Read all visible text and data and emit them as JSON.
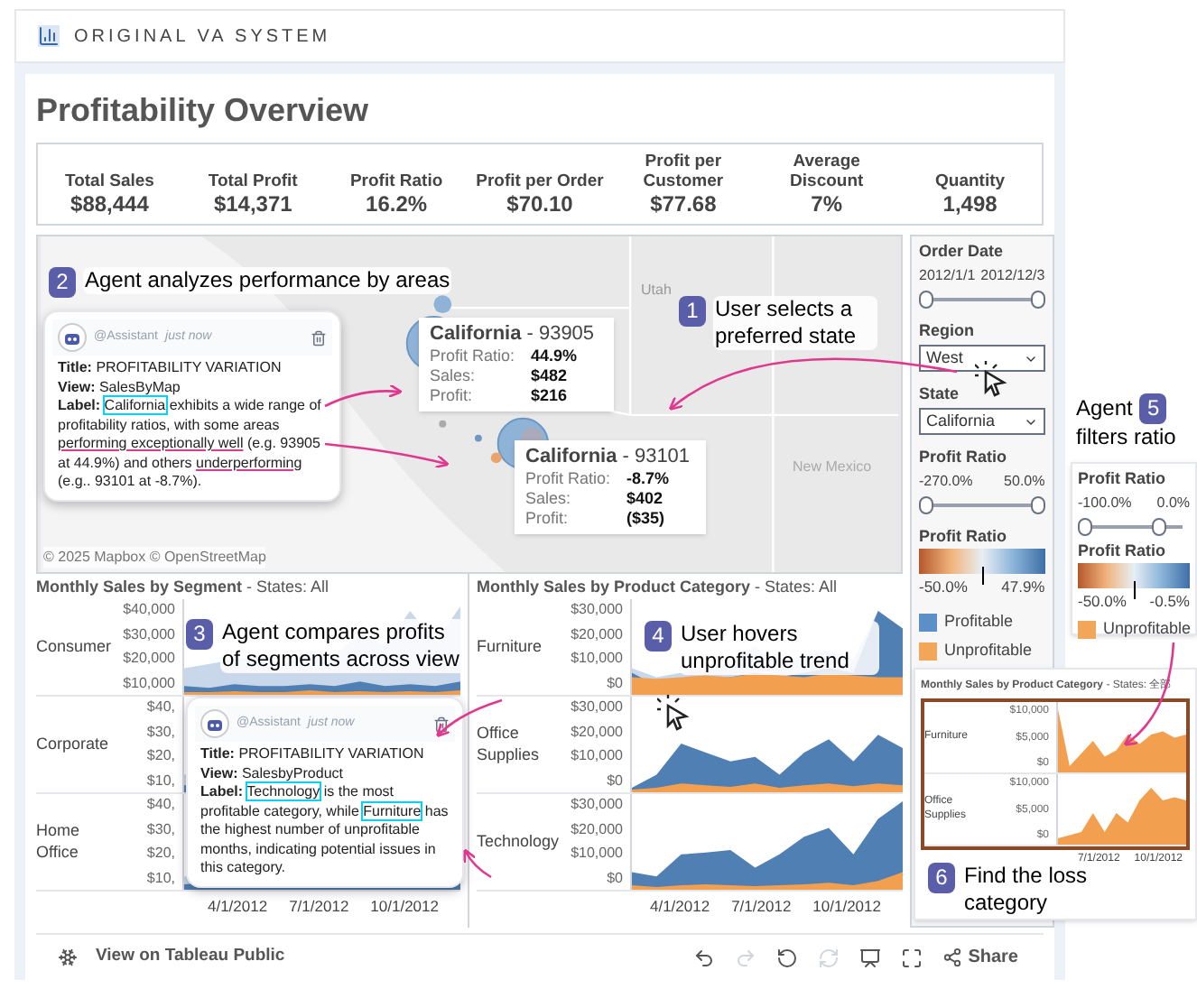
{
  "app": {
    "title": "ORIGINAL VA SYSTEM"
  },
  "dashboard": {
    "title": "Profitability Overview"
  },
  "kpis": [
    {
      "label": "Total Sales",
      "value": "$88,444"
    },
    {
      "label": "Total Profit",
      "value": "$14,371"
    },
    {
      "label": "Profit Ratio",
      "value": "16.2%"
    },
    {
      "label": "Profit per Order",
      "value": "$70.10"
    },
    {
      "label": "Profit per Customer",
      "value": "$77.68"
    },
    {
      "label": "Average Discount",
      "value": "7%"
    },
    {
      "label": "Quantity",
      "value": "1,498"
    }
  ],
  "map": {
    "place_labels": [
      "Utah",
      "New Mexico"
    ],
    "attribution": "© 2025 Mapbox © OpenStreetMap",
    "tooltips": [
      {
        "state": "California",
        "zip": "- 93905",
        "rows": [
          {
            "label": "Profit Ratio:",
            "value": "44.9%"
          },
          {
            "label": "Sales:",
            "value": "$482"
          },
          {
            "label": "Profit:",
            "value": "$216"
          }
        ]
      },
      {
        "state": "California",
        "zip": "- 93101",
        "rows": [
          {
            "label": "Profit Ratio:",
            "value": "-8.7%"
          },
          {
            "label": "Sales:",
            "value": "$402"
          },
          {
            "label": "Profit:",
            "value": "($35)"
          }
        ]
      }
    ]
  },
  "filters": [
    {
      "kind": "range",
      "label": "Order Date",
      "min": "2012/1/1",
      "max": "2012/12/3",
      "thumbs": [
        {
          "level": 0
        },
        {
          "level": 1
        }
      ]
    },
    {
      "kind": "dropdown",
      "label": "Region",
      "value": "West"
    },
    {
      "kind": "dropdown",
      "label": "State",
      "value": "California"
    },
    {
      "kind": "range",
      "label": "Profit Ratio",
      "min": "-270.0%",
      "max": "50.0%",
      "thumbs": [
        {
          "level": 0
        },
        {
          "level": 1
        }
      ]
    },
    {
      "kind": "gradient",
      "label": "Profit Ratio",
      "min": "-50.0%",
      "max": "47.9%",
      "level": 0.5
    },
    {
      "kind": "legend",
      "items": [
        {
          "label": "Profitable",
          "color": "#5b8fc7"
        },
        {
          "label": "Unprofitable",
          "color": "#f2a65a"
        }
      ]
    }
  ],
  "segment_chart": {
    "title": "Monthly Sales by Segment",
    "subtitle": " - States: All",
    "rows": [
      {
        "label": "Consumer",
        "ticks": [
          "$40,000",
          "$30,000",
          "$20,000",
          "$10,000"
        ]
      },
      {
        "label": "Corporate",
        "ticks": [
          "$40,",
          "$30,",
          "$20,",
          "$10,"
        ]
      },
      {
        "label": "Home Office",
        "ticks": [
          "$40,",
          "$30,",
          "$20,",
          "$10,"
        ]
      }
    ],
    "x_labels": [
      "4/1/2012",
      "7/1/2012",
      "10/1/2012"
    ]
  },
  "category_chart": {
    "title": "Monthly Sales by Product Category",
    "subtitle": " - States: All",
    "rows": [
      {
        "label": "Furniture",
        "ticks": [
          "$30,000",
          "$20,000",
          "$10,000",
          "$0"
        ]
      },
      {
        "label": "Office Supplies",
        "ticks": [
          "$30,000",
          "$20,000",
          "$10,000",
          "$0"
        ]
      },
      {
        "label": "Technology",
        "ticks": [
          "$30,000",
          "$20,000",
          "$10,000",
          "$0"
        ]
      }
    ],
    "x_labels": [
      "4/1/2012",
      "7/1/2012",
      "10/1/2012"
    ]
  },
  "agent_cards": [
    {
      "author": "@Assistant",
      "time": "just now",
      "title": "**Title:** PROFITABILITY VARIATION",
      "view": "**View:** SalesByMap",
      "label": [
        {
          "kind": "plain",
          "text": "**Label:** "
        },
        {
          "kind": "entity",
          "text": "California"
        },
        {
          "kind": "plain",
          "text": " exhibits a wide range of profitability ratios, with some areas "
        },
        {
          "kind": "underline",
          "text": "performing exceptionally well"
        },
        {
          "kind": "plain",
          "text": " (e.g. 93905 at 44.9%) and others "
        },
        {
          "kind": "underline",
          "text": "underperforming"
        },
        {
          "kind": "plain",
          "text": " (e.g.. 93101 at -8.7%)."
        }
      ]
    },
    {
      "author": "@Assistant",
      "time": "just now",
      "title": "**Title:** PROFITABILITY VARIATION",
      "view": "**View:** SalesbyProduct",
      "label": [
        {
          "kind": "plain",
          "text": "**Label:** "
        },
        {
          "kind": "entity",
          "text": "Technology"
        },
        {
          "kind": "plain",
          "text": " is the most profitable category, while "
        },
        {
          "kind": "entity",
          "text": "Furniture"
        },
        {
          "kind": "plain",
          "text": " has the highest number of unprofitable months, indicating potential issues in this category."
        }
      ]
    }
  ],
  "steps": [
    {
      "number": "1",
      "text": "User selects a preferred state"
    },
    {
      "number": "2",
      "text": "Agent analyzes performance by areas"
    },
    {
      "number": "3",
      "text": "Agent compares profits of segments across view"
    },
    {
      "number": "4",
      "text": "User hovers unprofitable trend"
    },
    {
      "number": "5",
      "prefix": "Agent",
      "text": "filters ratio"
    },
    {
      "number": "6",
      "text": "Find the loss category"
    }
  ],
  "zoomed_filters": [
    {
      "kind": "range",
      "label": "Profit Ratio",
      "min": "-100.0%",
      "max": "0.0%",
      "thumbs": [
        {
          "level": 0
        },
        {
          "level": 0.75
        }
      ]
    },
    {
      "kind": "gradient",
      "label": "Profit Ratio",
      "min": "-50.0%",
      "max": "-0.5%",
      "level": 0.5
    },
    {
      "kind": "legend",
      "items": [
        {
          "label": "Unprofitable",
          "color": "#f2a65a"
        }
      ]
    }
  ],
  "inset_chart": {
    "title": "Monthly Sales by Product Category",
    "subtitle": " - States: 全部",
    "rows": [
      {
        "label": "Furniture",
        "ticks": [
          "$10,000",
          "$5,000",
          "$0"
        ]
      },
      {
        "label": "Office Supplies",
        "ticks": [
          "$10,000",
          "$5,000",
          "$0"
        ]
      }
    ],
    "x_labels": [
      "7/1/2012",
      "10/1/2012"
    ]
  },
  "footer": {
    "link": "View on Tableau Public",
    "share": "Share"
  }
}
